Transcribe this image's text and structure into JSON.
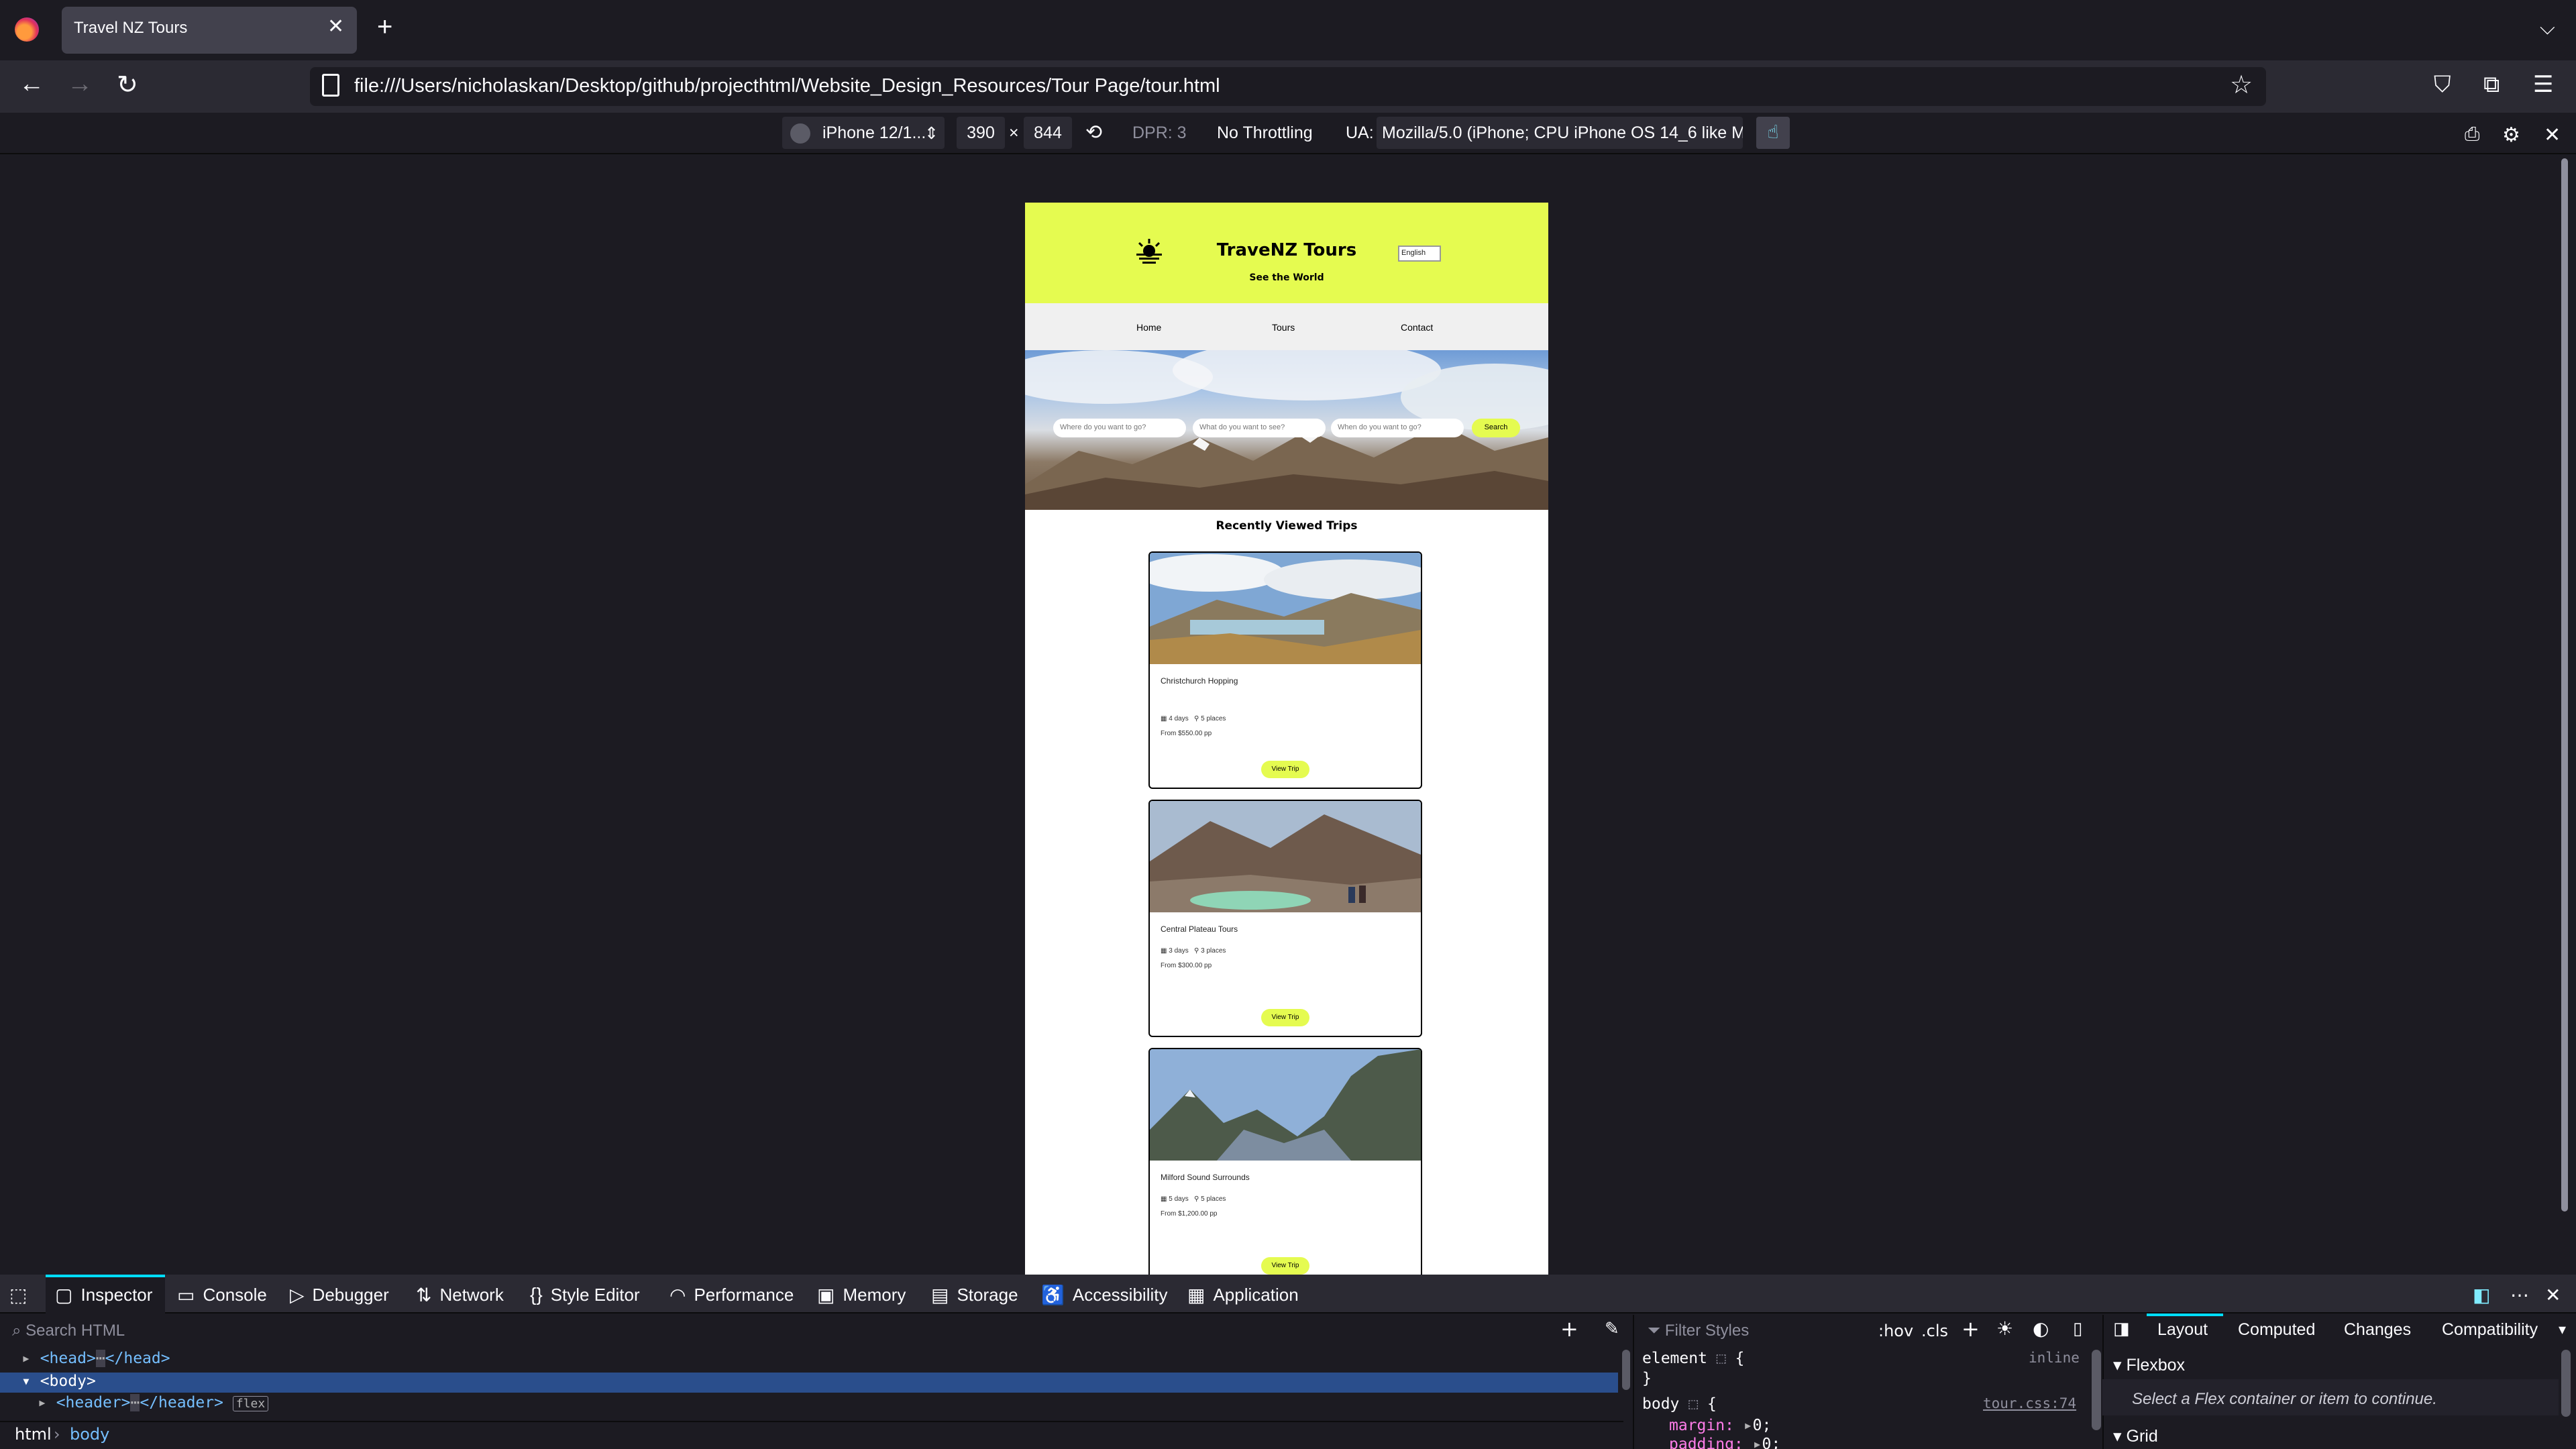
{
  "browser": {
    "tab_title": "Travel NZ Tours",
    "url": "file:///Users/nicholaskan/Desktop/github/projecthtml/Website_Design_Resources/Tour Page/tour.html"
  },
  "rdm": {
    "device": "iPhone 12/1...",
    "width": "390",
    "times": "×",
    "height": "844",
    "dpr": "DPR: 3",
    "throttling": "No Throttling",
    "ua_label": "UA:",
    "ua_value": "Mozilla/5.0 (iPhone; CPU iPhone OS 14_6 like M"
  },
  "site": {
    "title": "TraveNZ Tours",
    "subtitle": "See the World",
    "language": "English",
    "nav": [
      "Home",
      "Tours",
      "Contact"
    ],
    "search": {
      "where_placeholder": "Where do you want to go?",
      "what_placeholder": "What do you want to see?",
      "when_placeholder": "When do you want to go?",
      "button": "Search"
    },
    "recently_viewed_title": "Recently Viewed Trips",
    "trips": [
      {
        "name": "Christchurch Hopping",
        "days": "4 days",
        "places": "5 places",
        "price": "From $550.00 pp",
        "button": "View Trip"
      },
      {
        "name": "Central Plateau Tours",
        "days": "3 days",
        "places": "3 places",
        "price": "From $300.00 pp",
        "button": "View Trip"
      },
      {
        "name": "Milford Sound Surrounds",
        "days": "5 days",
        "places": "5 places",
        "price": "From $1,200.00 pp",
        "button": "View Trip"
      }
    ],
    "accent_color": "#e5fb50"
  },
  "devtools": {
    "tabs": [
      "Inspector",
      "Console",
      "Debugger",
      "Network",
      "Style Editor",
      "Performance",
      "Memory",
      "Storage",
      "Accessibility",
      "Application"
    ],
    "search_html_placeholder": "Search HTML",
    "tree": {
      "head_line": "<head>",
      "head_close": "</head>",
      "body_line": "<body>",
      "header_line": "<header>",
      "header_close": "</header>",
      "header_badge": "flex"
    },
    "breadcrumbs": [
      "html",
      "body"
    ],
    "styles": {
      "filter_placeholder": "Filter Styles",
      "hov": ":hov",
      "cls": ".cls",
      "element_rule": "element",
      "element_source": "inline",
      "body_rule": "body",
      "body_source": "tour.css:74",
      "margin_prop": "margin:",
      "margin_val": "0;",
      "padding_prop": "padding:",
      "padding_val": "0;"
    },
    "layout_tabs": [
      "Layout",
      "Computed",
      "Changes",
      "Compatibility"
    ],
    "flexbox_title": "Flexbox",
    "flexbox_hint": "Select a Flex container or item to continue.",
    "grid_title": "Grid"
  }
}
